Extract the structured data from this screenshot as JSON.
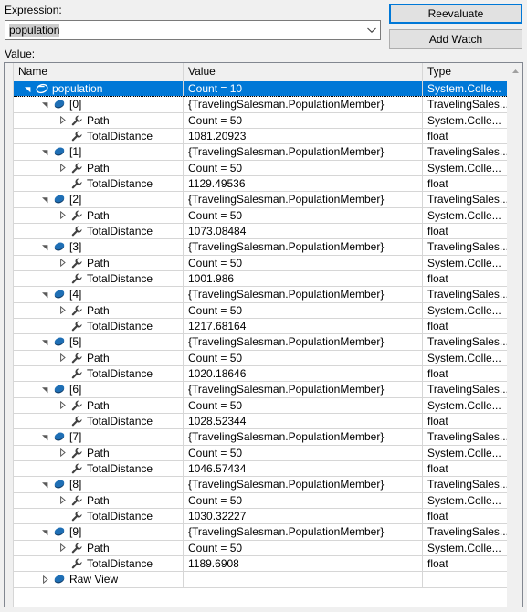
{
  "expression": {
    "label": "Expression:",
    "value": "population",
    "placeholder": "",
    "dropdown_icon": "chevron-down-icon"
  },
  "buttons": {
    "reevaluate": "Reevaluate",
    "add_watch": "Add Watch"
  },
  "value_section": {
    "label": "Value:"
  },
  "grid": {
    "columns": [
      "Name",
      "Value",
      "Type"
    ],
    "rows": [
      {
        "indent": 0,
        "expander": "expanded",
        "icon": "enumerable-icon",
        "name": "population",
        "value": "Count = 10",
        "type": "System.Colle...",
        "selected": true
      },
      {
        "indent": 1,
        "expander": "expanded",
        "icon": "class-icon",
        "name": "[0]",
        "value": "{TravelingSalesman.PopulationMember}",
        "type": "TravelingSales...",
        "selected": false
      },
      {
        "indent": 2,
        "expander": "collapsed",
        "icon": "property-icon",
        "name": "Path",
        "value": "Count = 50",
        "type": "System.Colle...",
        "selected": false
      },
      {
        "indent": 2,
        "expander": "none",
        "icon": "property-icon",
        "name": "TotalDistance",
        "value": "1081.20923",
        "type": "float",
        "selected": false
      },
      {
        "indent": 1,
        "expander": "expanded",
        "icon": "class-icon",
        "name": "[1]",
        "value": "{TravelingSalesman.PopulationMember}",
        "type": "TravelingSales...",
        "selected": false
      },
      {
        "indent": 2,
        "expander": "collapsed",
        "icon": "property-icon",
        "name": "Path",
        "value": "Count = 50",
        "type": "System.Colle...",
        "selected": false
      },
      {
        "indent": 2,
        "expander": "none",
        "icon": "property-icon",
        "name": "TotalDistance",
        "value": "1129.49536",
        "type": "float",
        "selected": false
      },
      {
        "indent": 1,
        "expander": "expanded",
        "icon": "class-icon",
        "name": "[2]",
        "value": "{TravelingSalesman.PopulationMember}",
        "type": "TravelingSales...",
        "selected": false
      },
      {
        "indent": 2,
        "expander": "collapsed",
        "icon": "property-icon",
        "name": "Path",
        "value": "Count = 50",
        "type": "System.Colle...",
        "selected": false
      },
      {
        "indent": 2,
        "expander": "none",
        "icon": "property-icon",
        "name": "TotalDistance",
        "value": "1073.08484",
        "type": "float",
        "selected": false
      },
      {
        "indent": 1,
        "expander": "expanded",
        "icon": "class-icon",
        "name": "[3]",
        "value": "{TravelingSalesman.PopulationMember}",
        "type": "TravelingSales...",
        "selected": false
      },
      {
        "indent": 2,
        "expander": "collapsed",
        "icon": "property-icon",
        "name": "Path",
        "value": "Count = 50",
        "type": "System.Colle...",
        "selected": false
      },
      {
        "indent": 2,
        "expander": "none",
        "icon": "property-icon",
        "name": "TotalDistance",
        "value": "1001.986",
        "type": "float",
        "selected": false
      },
      {
        "indent": 1,
        "expander": "expanded",
        "icon": "class-icon",
        "name": "[4]",
        "value": "{TravelingSalesman.PopulationMember}",
        "type": "TravelingSales...",
        "selected": false
      },
      {
        "indent": 2,
        "expander": "collapsed",
        "icon": "property-icon",
        "name": "Path",
        "value": "Count = 50",
        "type": "System.Colle...",
        "selected": false
      },
      {
        "indent": 2,
        "expander": "none",
        "icon": "property-icon",
        "name": "TotalDistance",
        "value": "1217.68164",
        "type": "float",
        "selected": false
      },
      {
        "indent": 1,
        "expander": "expanded",
        "icon": "class-icon",
        "name": "[5]",
        "value": "{TravelingSalesman.PopulationMember}",
        "type": "TravelingSales...",
        "selected": false
      },
      {
        "indent": 2,
        "expander": "collapsed",
        "icon": "property-icon",
        "name": "Path",
        "value": "Count = 50",
        "type": "System.Colle...",
        "selected": false
      },
      {
        "indent": 2,
        "expander": "none",
        "icon": "property-icon",
        "name": "TotalDistance",
        "value": "1020.18646",
        "type": "float",
        "selected": false
      },
      {
        "indent": 1,
        "expander": "expanded",
        "icon": "class-icon",
        "name": "[6]",
        "value": "{TravelingSalesman.PopulationMember}",
        "type": "TravelingSales...",
        "selected": false
      },
      {
        "indent": 2,
        "expander": "collapsed",
        "icon": "property-icon",
        "name": "Path",
        "value": "Count = 50",
        "type": "System.Colle...",
        "selected": false
      },
      {
        "indent": 2,
        "expander": "none",
        "icon": "property-icon",
        "name": "TotalDistance",
        "value": "1028.52344",
        "type": "float",
        "selected": false
      },
      {
        "indent": 1,
        "expander": "expanded",
        "icon": "class-icon",
        "name": "[7]",
        "value": "{TravelingSalesman.PopulationMember}",
        "type": "TravelingSales...",
        "selected": false
      },
      {
        "indent": 2,
        "expander": "collapsed",
        "icon": "property-icon",
        "name": "Path",
        "value": "Count = 50",
        "type": "System.Colle...",
        "selected": false
      },
      {
        "indent": 2,
        "expander": "none",
        "icon": "property-icon",
        "name": "TotalDistance",
        "value": "1046.57434",
        "type": "float",
        "selected": false
      },
      {
        "indent": 1,
        "expander": "expanded",
        "icon": "class-icon",
        "name": "[8]",
        "value": "{TravelingSalesman.PopulationMember}",
        "type": "TravelingSales...",
        "selected": false
      },
      {
        "indent": 2,
        "expander": "collapsed",
        "icon": "property-icon",
        "name": "Path",
        "value": "Count = 50",
        "type": "System.Colle...",
        "selected": false
      },
      {
        "indent": 2,
        "expander": "none",
        "icon": "property-icon",
        "name": "TotalDistance",
        "value": "1030.32227",
        "type": "float",
        "selected": false
      },
      {
        "indent": 1,
        "expander": "expanded",
        "icon": "class-icon",
        "name": "[9]",
        "value": "{TravelingSalesman.PopulationMember}",
        "type": "TravelingSales...",
        "selected": false
      },
      {
        "indent": 2,
        "expander": "collapsed",
        "icon": "property-icon",
        "name": "Path",
        "value": "Count = 50",
        "type": "System.Colle...",
        "selected": false
      },
      {
        "indent": 2,
        "expander": "none",
        "icon": "property-icon",
        "name": "TotalDistance",
        "value": "1189.6908",
        "type": "float",
        "selected": false
      },
      {
        "indent": 1,
        "expander": "collapsed",
        "icon": "class-icon",
        "name": "Raw View",
        "value": "",
        "type": "",
        "selected": false
      }
    ]
  },
  "scrollbar": {
    "up_arrow": "scroll-up-icon"
  },
  "colors": {
    "selection": "#0078d7",
    "focus_border": "#0078d7",
    "grid_line": "#d6d6d6",
    "chrome": "#f0f0f0"
  }
}
